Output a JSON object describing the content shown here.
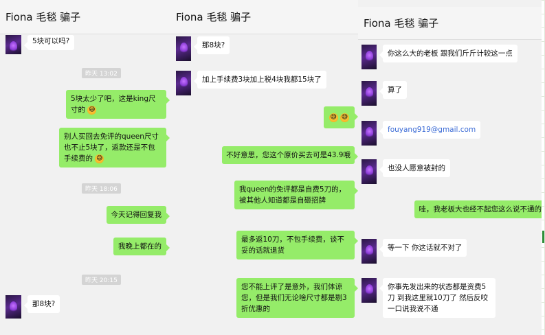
{
  "panels": [
    {
      "title": "Fiona  毛毯 骗子",
      "messages": [
        {
          "side": "in",
          "text": "5块可以吗?"
        },
        {
          "type": "time",
          "text": "昨天 13:02"
        },
        {
          "side": "out",
          "text": "5块太少了吧，这是king尺寸的"
        },
        {
          "side": "out",
          "text": "别人买回去免评的queen尺寸也不止5块了，返款还是不包手续费的"
        },
        {
          "type": "time",
          "text": "昨天 18:06"
        },
        {
          "side": "out",
          "text": "今天记得回复我"
        },
        {
          "side": "out",
          "text": "我晚上都在的"
        },
        {
          "type": "time",
          "text": "昨天 20:15"
        },
        {
          "side": "in",
          "text": "那8块?"
        }
      ]
    },
    {
      "title": "Fiona  毛毯 骗子",
      "messages": [
        {
          "side": "in",
          "text": "那8块?"
        },
        {
          "side": "in",
          "text": "加上手续费3块加上税4块我都15块了"
        },
        {
          "side": "out",
          "text": ""
        },
        {
          "side": "out",
          "text": "不好意思，您这个原价买去可是43.9哦"
        },
        {
          "side": "out",
          "text": "我queen的免评都是自费5刀的，被其他人知道都是自砸招牌"
        },
        {
          "side": "out",
          "text": "最多返10刀，不包手续费，谈不妥的话就退货"
        },
        {
          "side": "out",
          "text": "您不能上评了是意外，我们体谅您，但是我们无论啥尺寸都是剔3折优惠的"
        }
      ]
    },
    {
      "title": "Fiona  毛毯 骗子",
      "messages": [
        {
          "side": "in",
          "text": "你这么大的老板 跟我们斤斤计较这一点"
        },
        {
          "side": "in",
          "text": "算了"
        },
        {
          "side": "in",
          "text": "fouyang919@gmail.com"
        },
        {
          "side": "in",
          "text": "也没人愿意被封的"
        },
        {
          "side": "out",
          "text": "哇，我老板大也经不起您这么说不通的"
        },
        {
          "side": "in",
          "text": "等一下 你这话就不对了"
        },
        {
          "side": "in",
          "text": "你事先发出来的状态都是资费5刀 到我这里就10刀了 然后反咬一口说我说不通"
        }
      ]
    }
  ],
  "colors": {
    "outgoing_bubble": "#95ec69",
    "incoming_bubble": "#ffffff",
    "link": "#3b6bd6"
  },
  "icons": {
    "emoji": "grinning-sweat-emoji",
    "avatar": "purple-cat-avatar"
  }
}
